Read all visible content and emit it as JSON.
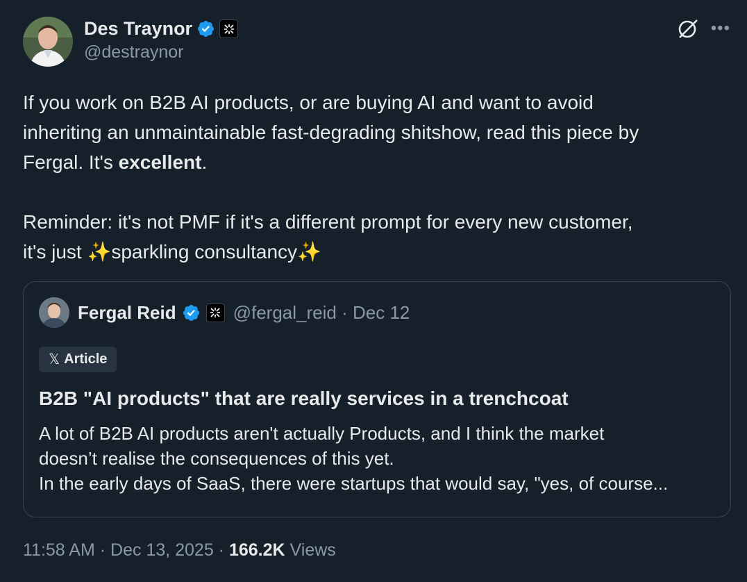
{
  "author": {
    "name": "Des Traynor",
    "handle": "@destraynor"
  },
  "tweet": {
    "line1": "If you work on B2B AI products, or are buying AI and want to avoid",
    "line2": "inheriting an unmaintainable fast-degrading shitshow, read this piece by",
    "line3_prefix": "Fergal. It's ",
    "line3_bold": "excellent",
    "line3_suffix": ".",
    "line4": "Reminder: it's not PMF if it's a different prompt for every new customer,",
    "line5_prefix": "it's just ",
    "line5_sparkle": "✨",
    "line5_middle": "sparkling consultancy",
    "line5_sparkle_end": "✨"
  },
  "quote": {
    "name": "Fergal Reid",
    "handle": "@fergal_reid",
    "separator": "·",
    "date": "Dec 12",
    "tag_logo": "𝕏",
    "tag_label": "Article",
    "title": "B2B \"AI products\" that are really services in a trenchcoat",
    "body_line1": "A lot of B2B AI products aren't actually Products, and I think the market",
    "body_line2": "doesn’t realise the consequences of this yet.",
    "body_line3": "In the early days of SaaS, there were startups that would say, \"yes, of course..."
  },
  "footer": {
    "time": "11:58 AM",
    "sep1": "·",
    "date": "Dec 13, 2025",
    "sep2": "·",
    "views_count": "166.2K",
    "views_label": "Views"
  },
  "colors": {
    "background": "#15202b",
    "text": "#e7e9ea",
    "muted": "#8b98a5",
    "verified": "#1d9bf0",
    "border": "#38444d"
  },
  "icons": {
    "verified": "verified-check-icon",
    "org_badge": "org-badge-icon",
    "grok": "grok-icon",
    "more": "more-options-icon"
  }
}
